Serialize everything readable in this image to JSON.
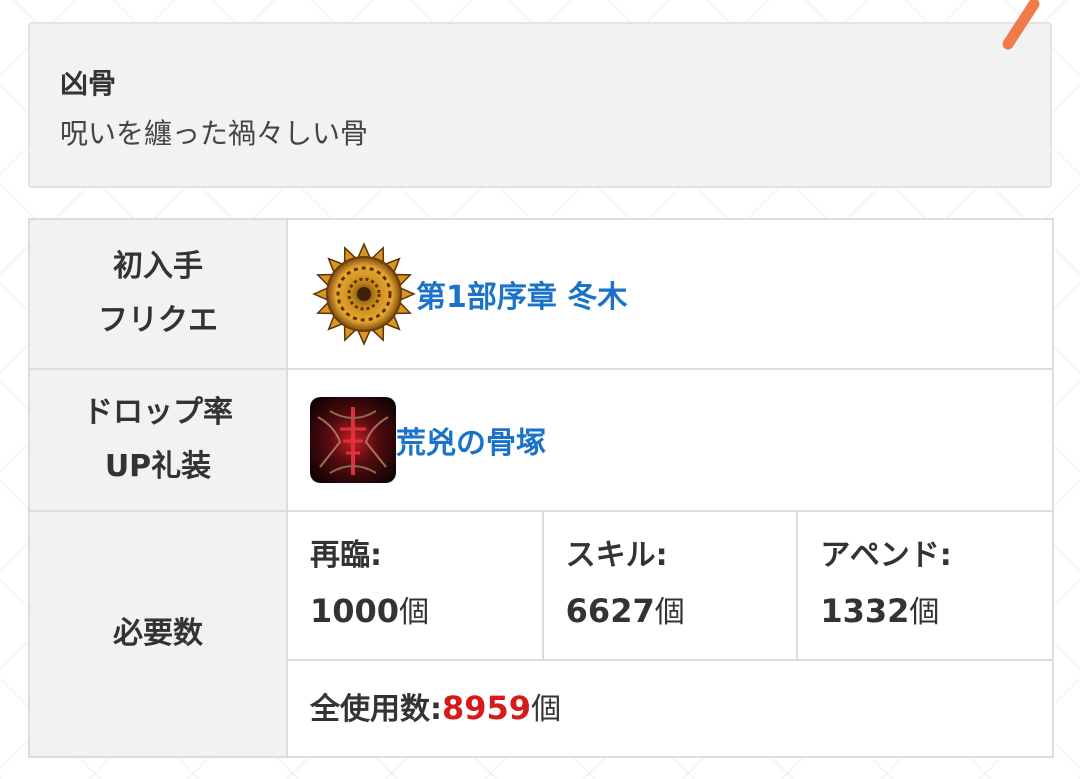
{
  "item": {
    "name": "凶骨",
    "description": "呪いを纏った禍々しい骨"
  },
  "rows": {
    "first_acquire": {
      "label_line1": "初入手",
      "label_line2": "フリクエ",
      "link_text": "第1部序章 冬木"
    },
    "drop_up": {
      "label_line1": "ドロップ率",
      "label_line2": "UP礼装",
      "link_text": "荒兇の骨塚"
    },
    "required": {
      "label": "必要数",
      "ascension_label": "再臨:",
      "ascension_value": "1000",
      "skill_label": "スキル:",
      "skill_value": "6627",
      "append_label": "アペンド:",
      "append_value": "1332",
      "unit": "個",
      "total_label": "全使用数:",
      "total_value": "8959"
    }
  },
  "colors": {
    "link": "#1a73c8",
    "total_highlight": "#d71a1a",
    "edit_mark": "#f07a4a"
  },
  "icons": {
    "quest": "bone-spiral-icon",
    "craft_essence": "craft-essence-thumbnail",
    "edit": "edit-mark-icon"
  }
}
